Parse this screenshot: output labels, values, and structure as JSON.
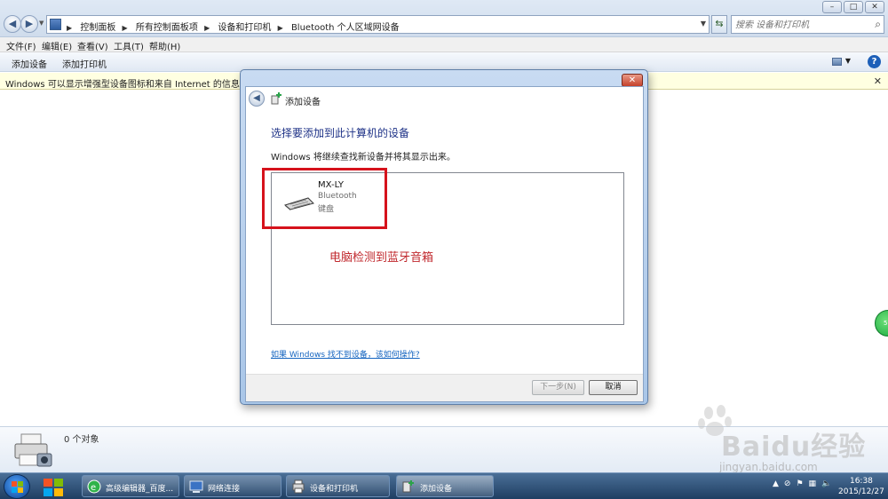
{
  "address_bar": {
    "breadcrumbs": [
      "控制面板",
      "所有控制面板项",
      "设备和打印机",
      "Bluetooth 个人区域网设备"
    ],
    "search_placeholder": "搜索 设备和打印机"
  },
  "menu": {
    "items": [
      "文件(F)",
      "编辑(E)",
      "查看(V)",
      "工具(T)",
      "帮助(H)"
    ]
  },
  "command_bar": {
    "add_device": "添加设备",
    "add_printer": "添加打印机"
  },
  "info_bar": {
    "text": "Windows 可以显示增强型设备图标和来自 Internet 的信息。请单击"
  },
  "details_pane": {
    "count_text": "0 个对象"
  },
  "dialog": {
    "title": "添加设备",
    "heading": "选择要添加到此计算机的设备",
    "subtitle": "Windows 将继续查找新设备并将其显示出来。",
    "device": {
      "name": "MX-LY",
      "type": "Bluetooth",
      "category": "键盘"
    },
    "annotation": "电脑检测到蓝牙音箱",
    "help_link": "如果 Windows 找不到设备，该如何操作?",
    "next_button": "下一步(N)",
    "cancel_button": "取消"
  },
  "taskbar": {
    "items": [
      {
        "label": "高级编辑器_百度..."
      },
      {
        "label": "网络连接"
      },
      {
        "label": "设备和打印机"
      },
      {
        "label": "添加设备"
      }
    ],
    "clock_time": "16:38",
    "clock_date": "2015/12/27"
  },
  "watermark": {
    "text": "Baidu经验",
    "url": "jingyan.baidu.com"
  },
  "colors": {
    "annotation_red": "#d6121c",
    "link_blue": "#1565c0",
    "heading_blue": "#1e3287"
  }
}
